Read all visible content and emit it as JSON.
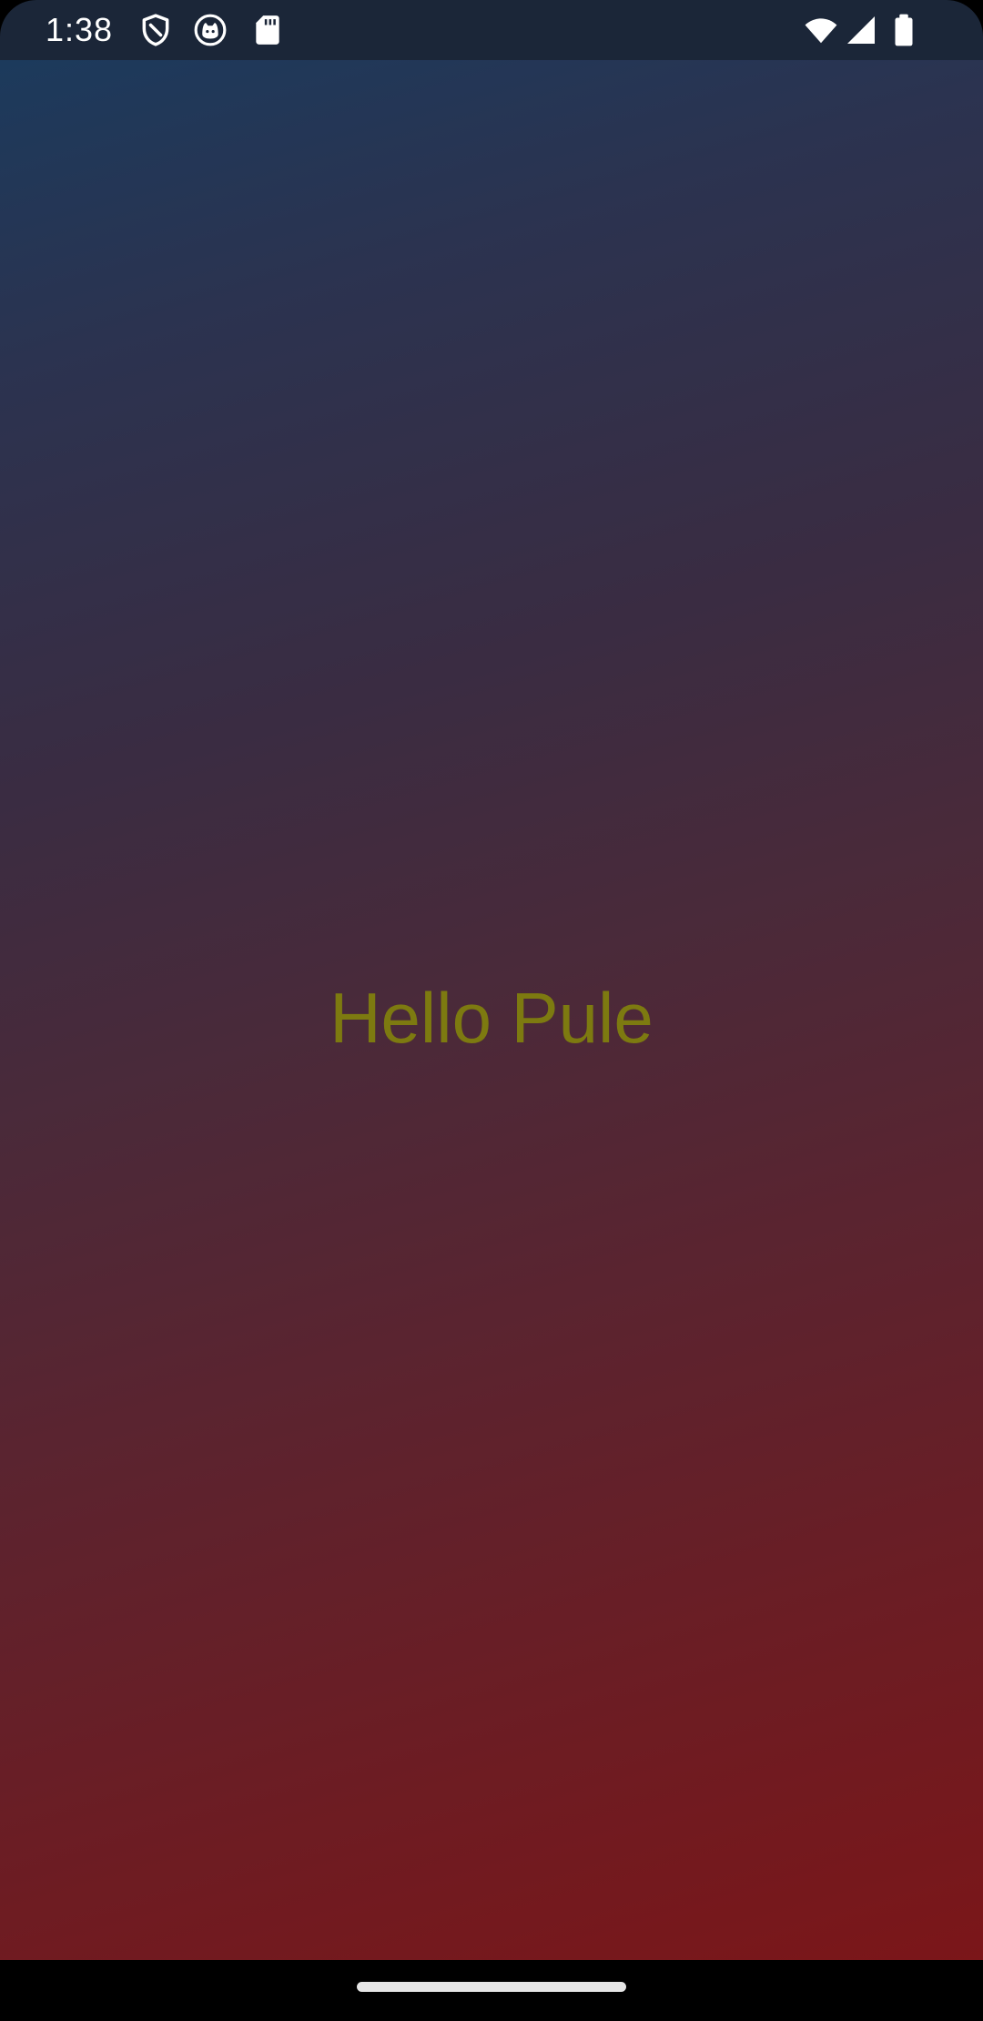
{
  "status_bar": {
    "time": "1:38",
    "left_icons": [
      "shield-icon",
      "cat-face-icon",
      "sd-card-icon"
    ],
    "right_icons": [
      "wifi-icon",
      "cell-signal-icon",
      "battery-icon"
    ]
  },
  "main": {
    "greeting": "Hello Pule"
  },
  "colors": {
    "status_bar_bg": "#1b2638",
    "gradient_top": "#1c3a5c",
    "gradient_bottom": "#7b1619",
    "greeting_text": "#7d7a10",
    "nav_bar_bg": "#000000"
  }
}
